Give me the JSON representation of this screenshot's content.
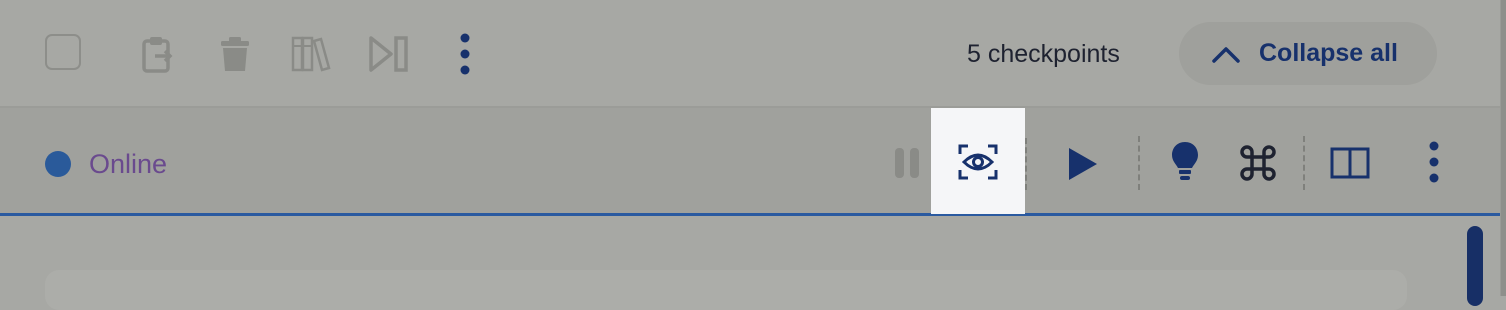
{
  "toolbar": {
    "checkpoints_label": "5 checkpoints",
    "collapse_label": "Collapse all",
    "icons": [
      "checkbox",
      "clipboard-icon",
      "trash-icon",
      "library-icon",
      "step-forward-icon",
      "more-vertical-icon"
    ]
  },
  "status": {
    "label": "Online",
    "dot_color": "#2a5a9a",
    "icons": [
      "pause-icon",
      "eye-focus-icon",
      "play-icon",
      "lightbulb-icon",
      "command-icon",
      "split-view-icon",
      "more-vertical-icon"
    ]
  },
  "colors": {
    "accent": "#17316c",
    "status_text": "#6a4a8e",
    "highlight": "#f5f6f8"
  }
}
